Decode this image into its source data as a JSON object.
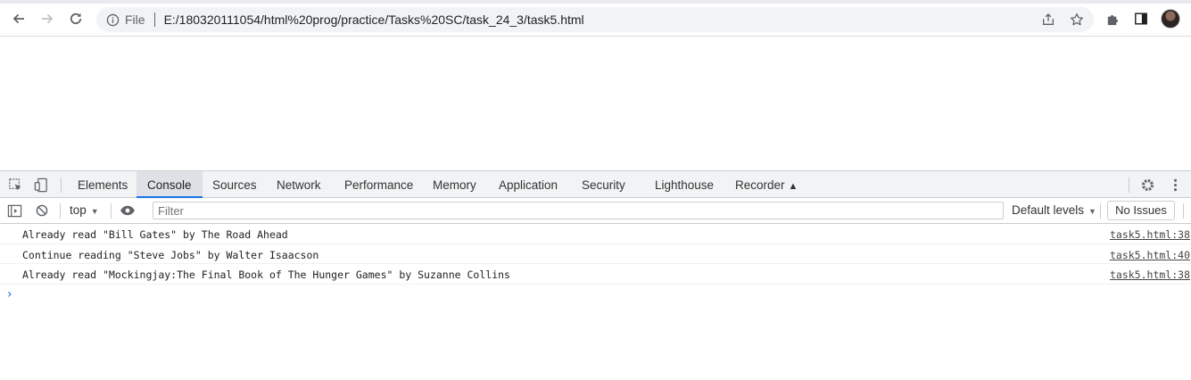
{
  "browser": {
    "security_label": "File",
    "url": "E:/180320111054/html%20prog/practice/Tasks%20SC/task_24_3/task5.html",
    "icons": [
      "back-arrow-icon",
      "forward-arrow-icon",
      "reload-icon",
      "info-icon",
      "share-icon",
      "star-icon",
      "extensions-icon",
      "side-panel-icon",
      "profile-avatar"
    ]
  },
  "devtools": {
    "tabs": [
      "Elements",
      "Console",
      "Sources",
      "Network",
      "Performance",
      "Memory",
      "Application",
      "Security",
      "Lighthouse",
      "Recorder"
    ],
    "active_tab": "Console",
    "context": "top",
    "filter_placeholder": "Filter",
    "levels": "Default levels",
    "issues": "No Issues",
    "messages": [
      {
        "text": "Already read \"Bill Gates\" by The Road Ahead",
        "source": "task5.html:38"
      },
      {
        "text": "Continue reading \"Steve Jobs\" by Walter Isaacson",
        "source": "task5.html:40"
      },
      {
        "text": "Already read \"Mockingjay:The Final Book of The Hunger Games\" by Suzanne Collins",
        "source": "task5.html:38"
      }
    ],
    "accent_color": "#1a73e8"
  }
}
